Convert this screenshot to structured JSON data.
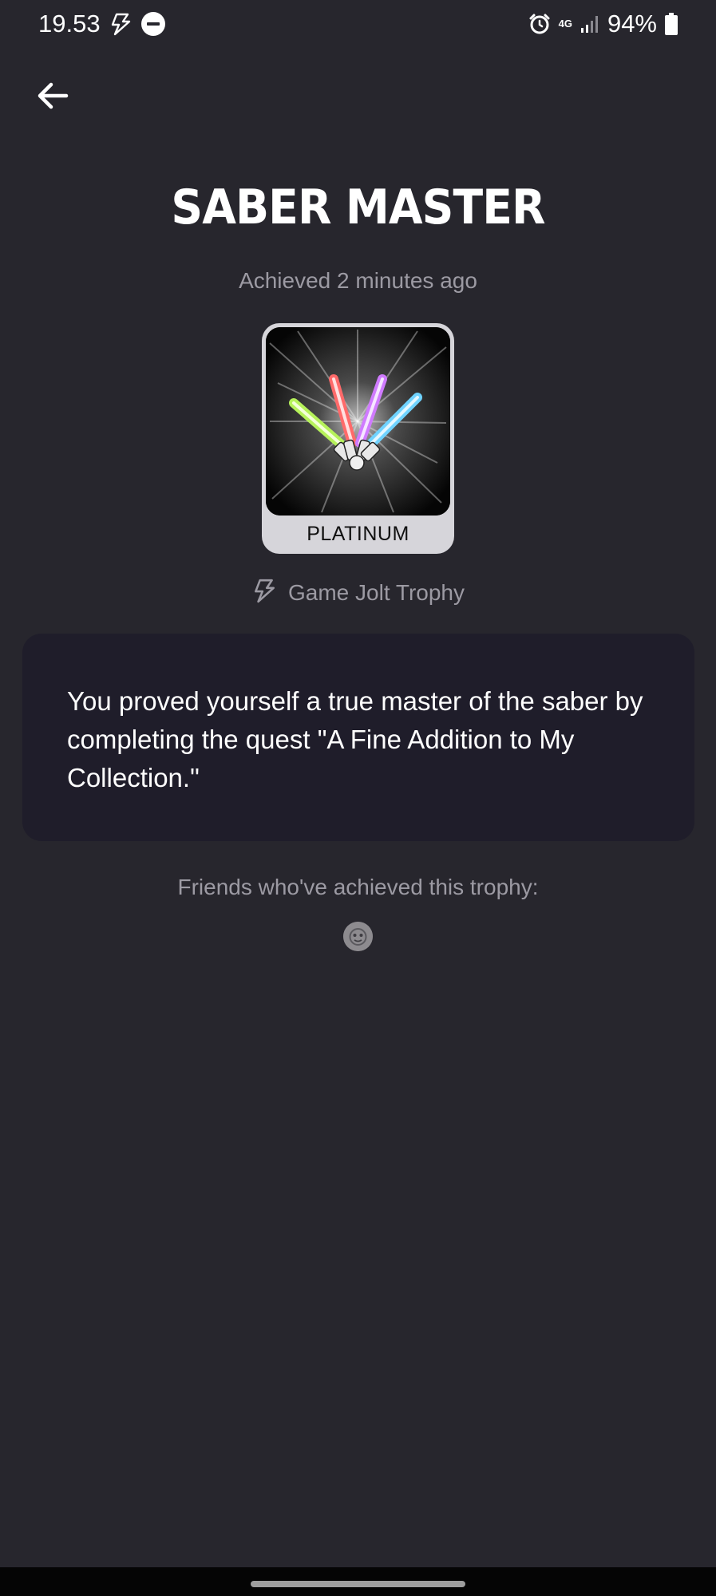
{
  "status_bar": {
    "time": "19.53",
    "network": "4G",
    "battery_percent": "94%",
    "icons": [
      "game-jolt-bolt-icon",
      "do-not-disturb-icon",
      "alarm-icon",
      "network-4g-icon",
      "signal-icon",
      "battery-icon"
    ]
  },
  "header": {
    "back_icon": "back-arrow-icon"
  },
  "trophy": {
    "title": "SABER MASTER",
    "achieved": "Achieved 2 minutes ago",
    "tier": "PLATINUM",
    "source_icon": "game-jolt-bolt-icon",
    "source": "Game Jolt Trophy",
    "description": "You proved yourself a true master of the saber by completing the quest \"A Fine Addition to My Collection.\""
  },
  "friends": {
    "label": "Friends who've achieved this trophy:",
    "count_shown": 1
  },
  "colors": {
    "background": "#27262d",
    "card": "#1f1d2a",
    "muted_text": "#9c9aa3",
    "tier_badge": "#d6d5da",
    "saber_green": "#b6f25a",
    "saber_red": "#ff6a6a",
    "saber_purple": "#d07bff",
    "saber_blue": "#6fd3ff"
  }
}
